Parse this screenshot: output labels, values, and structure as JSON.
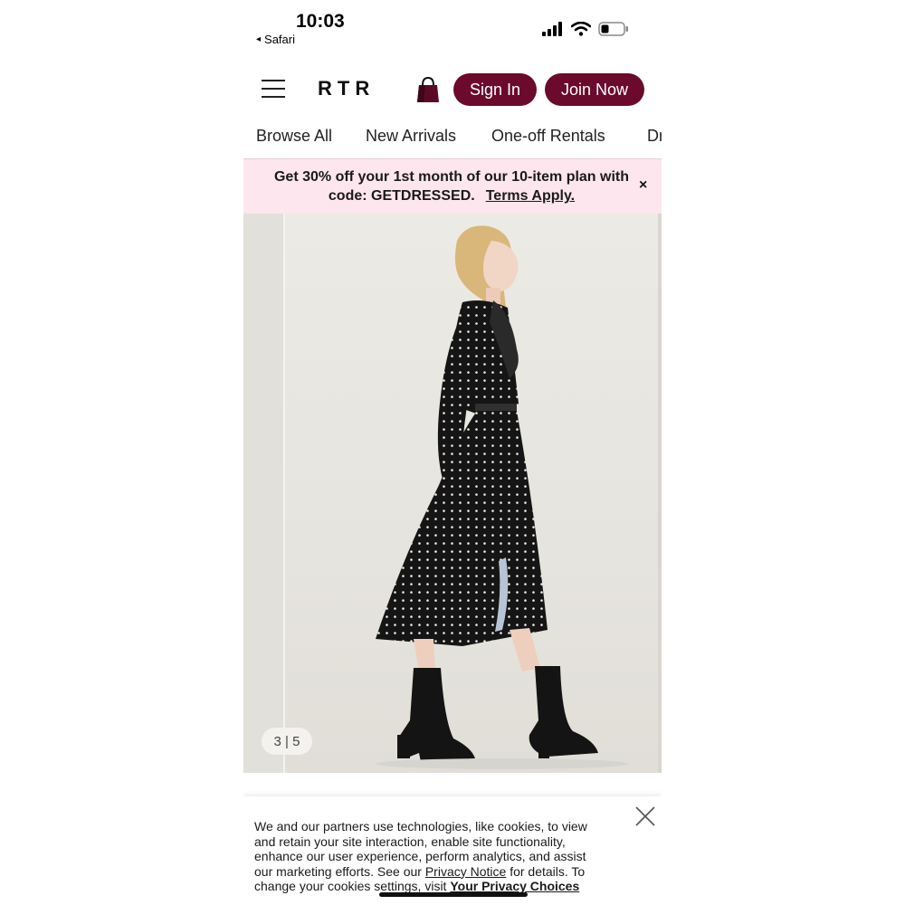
{
  "status_bar": {
    "time": "10:03",
    "back_app": "Safari",
    "back_glyph": "◂"
  },
  "header": {
    "logo": "RTR",
    "sign_in_label": "Sign In",
    "join_now_label": "Join Now"
  },
  "categories": [
    {
      "label": "Browse All"
    },
    {
      "label": "New Arrivals"
    },
    {
      "label": "One-off Rentals"
    },
    {
      "label": "Dr"
    }
  ],
  "promo": {
    "text_line1": "Get 30% off your 1st month of our 10-item plan with",
    "text_line2": "code: GETDRESSED.",
    "terms_label": "Terms Apply.",
    "close_glyph": "×"
  },
  "gallery": {
    "counter": "3 | 5"
  },
  "cookie_banner": {
    "text_part1": "We and our partners use technologies, like cookies, to view and retain your site interaction, enable site functionality, enhance our user experience, perform analytics, and assist our marketing efforts. See our ",
    "privacy_notice_label": "Privacy Notice",
    "text_part2": " for details. To change your cookies settings, visit ",
    "privacy_choices_label": "Your Privacy Choices"
  },
  "colors": {
    "brand_burgundy": "#6b0a2c",
    "promo_pink": "#fde6ee",
    "photo_background": "#e8e6e1"
  },
  "icons": {
    "menu": "hamburger-menu-icon",
    "bag": "shopping-bag-icon",
    "signal": "cellular-signal-icon",
    "wifi": "wifi-icon",
    "battery": "battery-icon",
    "close": "close-icon"
  }
}
